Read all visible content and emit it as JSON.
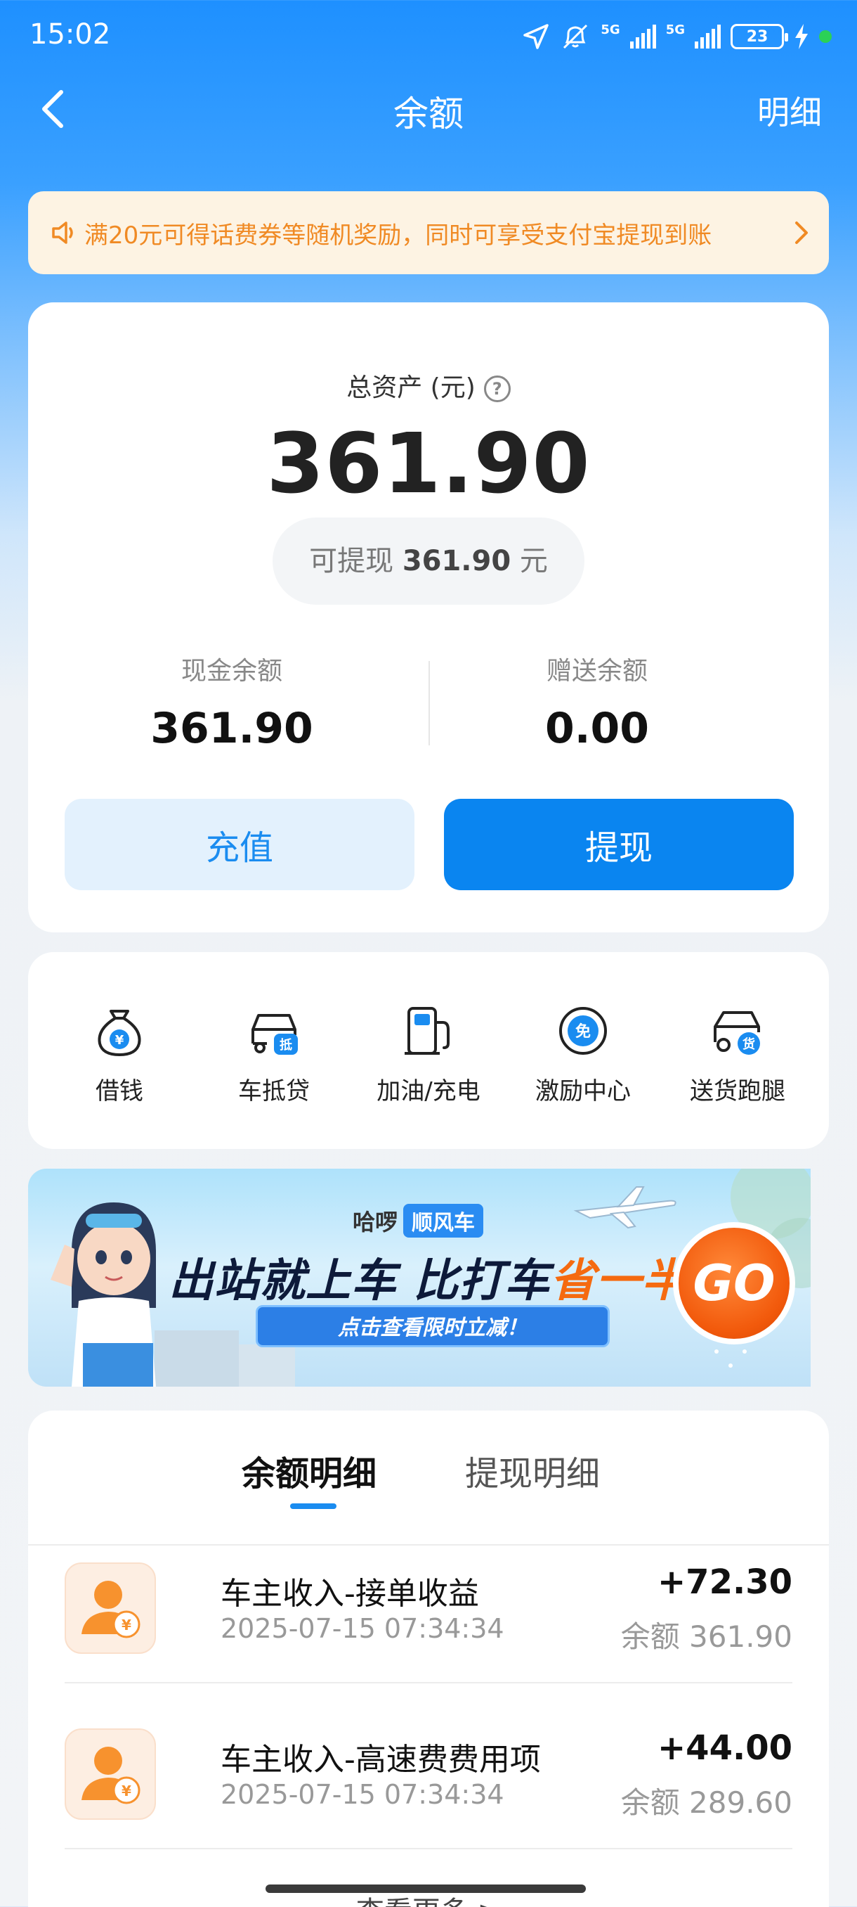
{
  "status_bar": {
    "time": "15:02",
    "network_1": "5G",
    "network_2": "5G",
    "battery": "23"
  },
  "nav": {
    "title": "余额",
    "detail_link": "明细"
  },
  "notice": {
    "text": "满20元可得话费券等随机奖励，同时可享受支付宝提现到账"
  },
  "balance": {
    "total_label": "总资产 (元)",
    "total_amount": "361.90",
    "withdrawable_prefix": "可提现",
    "withdrawable_amount": "361.90",
    "withdrawable_unit": "元",
    "cash_label": "现金余额",
    "cash_value": "361.90",
    "gift_label": "赠送余额",
    "gift_value": "0.00",
    "recharge_button": "充值",
    "withdraw_button": "提现"
  },
  "services": [
    {
      "label": "借钱",
      "icon": "money-bag-icon"
    },
    {
      "label": "车抵贷",
      "icon": "car-loan-icon"
    },
    {
      "label": "加油/充电",
      "icon": "fuel-pump-icon"
    },
    {
      "label": "激励中心",
      "icon": "free-badge-icon"
    },
    {
      "label": "送货跑腿",
      "icon": "delivery-truck-icon"
    }
  ],
  "banner": {
    "brand": "哈啰",
    "brand_tag": "顺风车",
    "headline_main": "出站就上车 比打车",
    "headline_highlight": "省一半",
    "cta": "点击查看限时立减！",
    "go": "GO"
  },
  "records": {
    "tab_balance": "余额明细",
    "tab_withdraw": "提现明细",
    "items": [
      {
        "title": "车主收入-接单收益",
        "time": "2025-07-15 07:34:34",
        "amount": "+72.30",
        "balance": "余额 361.90"
      },
      {
        "title": "车主收入-高速费费用项",
        "time": "2025-07-15 07:34:34",
        "amount": "+44.00",
        "balance": "余额 289.60"
      }
    ],
    "view_more": "查看更多 >"
  },
  "colors": {
    "primary": "#0a85f0",
    "notice_text": "#f08a24",
    "notice_bg": "#fdf3e3",
    "accent_orange": "#f56a10"
  }
}
